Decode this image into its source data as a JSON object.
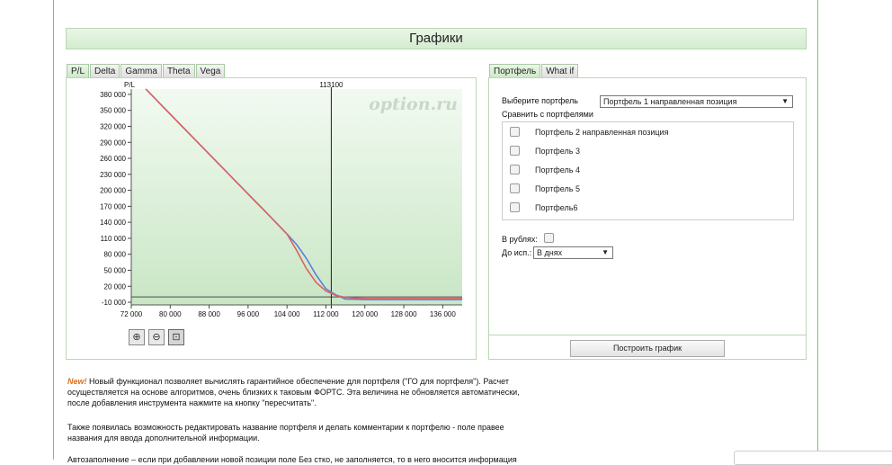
{
  "page": {
    "title": "Графики"
  },
  "chart_tabs": [
    "P/L",
    "Delta",
    "Gamma",
    "Theta",
    "Vega"
  ],
  "portfolio_tabs": [
    "Портфель",
    "What if"
  ],
  "watermark": "option.ru",
  "chart_data": {
    "type": "line",
    "ylabel": "P/L",
    "marker_label": "113100",
    "marker_x": 113100,
    "xlim": [
      72000,
      140000
    ],
    "ylim": [
      -15000,
      390000
    ],
    "x_ticks": [
      "72 000",
      "80 000",
      "88 000",
      "96 000",
      "104 000",
      "112 000",
      "120 000",
      "128 000",
      "136 000"
    ],
    "y_ticks": [
      "380 000",
      "350 000",
      "320 000",
      "290 000",
      "260 000",
      "230 000",
      "200 000",
      "170 000",
      "140 000",
      "110 000",
      "80 000",
      "50 000",
      "20 000",
      "-10 000"
    ],
    "series": [
      {
        "color": "#e06060",
        "x": [
          75000,
          80000,
          88000,
          96000,
          100000,
          104000,
          106000,
          108000,
          110000,
          112000,
          114000,
          116000,
          120000,
          128000,
          140000
        ],
        "y": [
          390000,
          343000,
          268000,
          193000,
          156000,
          118000,
          87000,
          53000,
          27000,
          11000,
          3000,
          -1000,
          -3000,
          -3000,
          -3000
        ]
      },
      {
        "color": "#5b7fe0",
        "x": [
          75000,
          80000,
          88000,
          96000,
          100000,
          104000,
          106000,
          108000,
          110000,
          112000,
          114000,
          116000,
          120000,
          128000,
          140000
        ],
        "y": [
          390000,
          343000,
          268000,
          193000,
          156000,
          118000,
          98000,
          72000,
          41000,
          15000,
          4000,
          -4000,
          -5000,
          -5000,
          -5000
        ]
      }
    ]
  },
  "zoom_buttons": [
    "zoom-in",
    "zoom-out",
    "zoom-fit"
  ],
  "zoom_glyphs": [
    "⊕",
    "⊖",
    "⊡"
  ],
  "portfolio": {
    "select_label": "Выберите портфель",
    "selected": "Портфель 1 направленная позиция",
    "compare_label": "Сравнить с портфелями",
    "compare_items": [
      "Портфель 2 направленная позиция",
      "Портфель 3",
      "Портфель 4",
      "Портфель 5",
      "Портфель6"
    ],
    "rubles_label": "В рублях:",
    "expiry_label": "До исп.:",
    "expiry_value": "В днях",
    "build_button": "Построить график"
  },
  "info": {
    "new_badge": "New!",
    "paragraph1_line1": "Новый функционал позволяет вычислять гарантийное обеспечение для портфеля (\"ГО для портфеля\"). Расчет",
    "paragraph1_line2": "осуществляется на основе алгоритмов, очень близких к таковым ФОРТС. Эта величина не обновляется автоматически,",
    "paragraph1_line3": "после добавления инструмента нажмите на кнопку \"пересчитать\".",
    "paragraph2_line1": "Также появилась возможность редактировать название портфеля и делать комментарии к портфелю - поле правее",
    "paragraph2_line2": "названия для ввода дополнительной информации.",
    "paragraph3_line1": "Автозаполнение – если при добавлении новой позиции поле Без стко, не заполняется, то в него вносится информация"
  }
}
